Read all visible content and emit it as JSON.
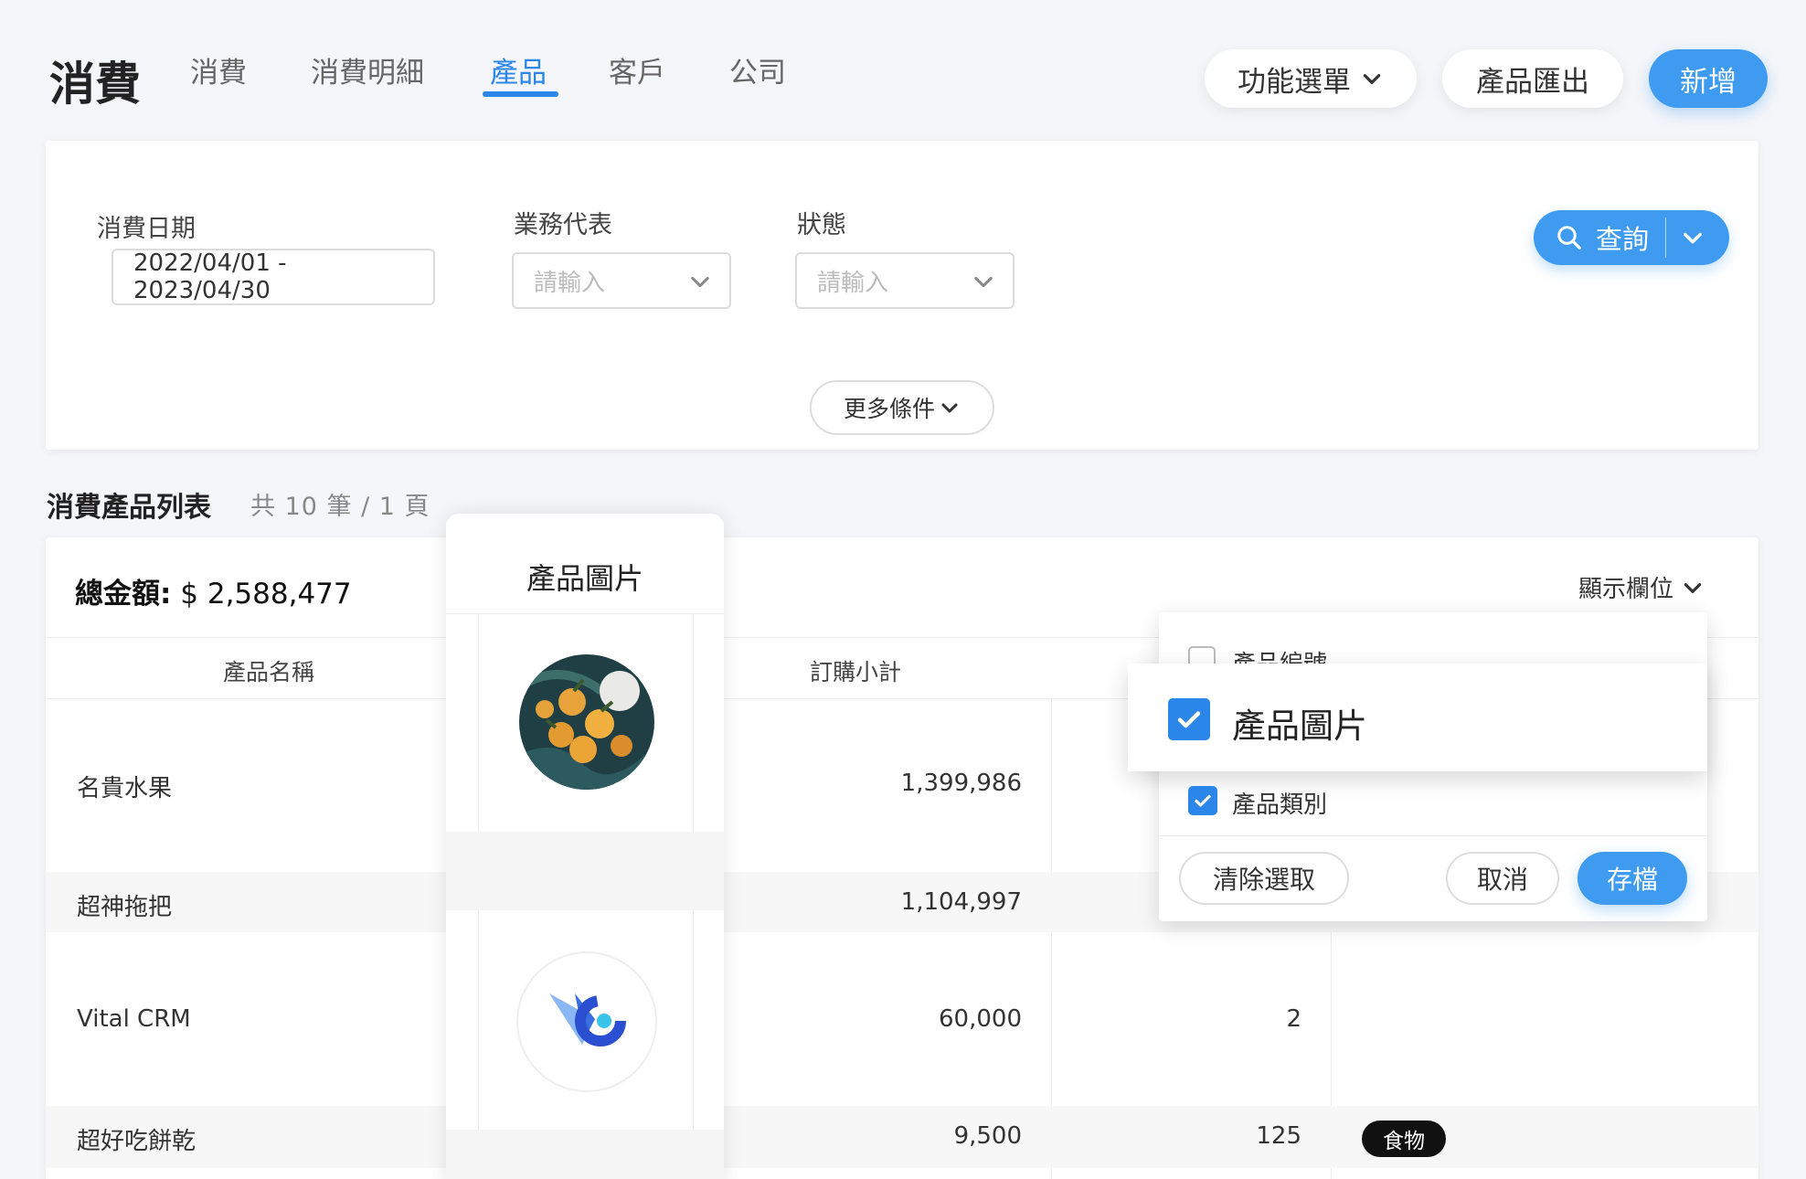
{
  "header": {
    "title": "消費",
    "tabs": [
      "消費",
      "消費明細",
      "產品",
      "客戶",
      "公司"
    ],
    "active_tab": "產品",
    "function_menu": "功能選單",
    "export": "產品匯出",
    "add": "新增"
  },
  "filters": {
    "date_label": "消費日期",
    "date_value": "2022/04/01 - 2023/04/30",
    "rep_label": "業務代表",
    "rep_placeholder": "請輸入",
    "status_label": "狀態",
    "status_placeholder": "請輸入",
    "query": "查詢",
    "more": "更多條件"
  },
  "list": {
    "title": "消費產品列表",
    "count": "共 10 筆 / 1 頁",
    "total_label": "總金額:",
    "total_value": "$ 2,588,477",
    "show_columns": "顯示欄位",
    "columns": {
      "name": "產品名稱",
      "image": "產品圖片",
      "subtotal": "訂購小計"
    },
    "rows": [
      {
        "name": "名貴水果",
        "subtotal": "1,399,986",
        "qty": "",
        "category": ""
      },
      {
        "name": "超神拖把",
        "subtotal": "1,104,997",
        "qty": "",
        "category": ""
      },
      {
        "name": "Vital CRM",
        "subtotal": "60,000",
        "qty": "2",
        "category": ""
      },
      {
        "name": "超好吃餅乾",
        "subtotal": "9,500",
        "qty": "125",
        "category": "食物"
      }
    ]
  },
  "column_picker": {
    "items": [
      {
        "label": "產品編號",
        "checked": false
      },
      {
        "label": "產品圖片",
        "checked": true
      },
      {
        "label": "產品類別",
        "checked": true
      }
    ],
    "clear": "清除選取",
    "cancel": "取消",
    "save": "存檔"
  },
  "colors": {
    "accent": "#2a86e8",
    "button_blue": "#3e9bf0",
    "badge_bg": "#111111"
  }
}
